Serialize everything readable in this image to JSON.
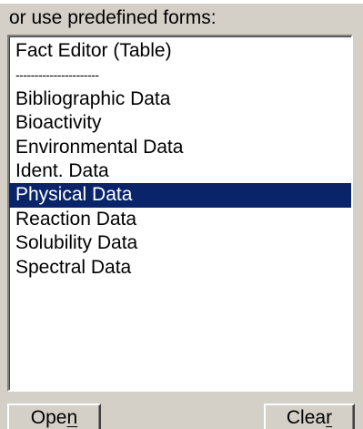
{
  "panel": {
    "caption": "or use predefined forms:",
    "forms": [
      {
        "label": "Fact Editor (Table)",
        "kind": "item",
        "selected": false
      },
      {
        "label": "----------------------",
        "kind": "separator",
        "selected": false
      },
      {
        "label": "Bibliographic Data",
        "kind": "item",
        "selected": false
      },
      {
        "label": "Bioactivity",
        "kind": "item",
        "selected": false
      },
      {
        "label": "Environmental Data",
        "kind": "item",
        "selected": false
      },
      {
        "label": "Ident. Data",
        "kind": "item",
        "selected": false
      },
      {
        "label": "Physical Data",
        "kind": "item",
        "selected": true
      },
      {
        "label": "Reaction Data",
        "kind": "item",
        "selected": false
      },
      {
        "label": "Solubility Data",
        "kind": "item",
        "selected": false
      },
      {
        "label": "Spectral Data",
        "kind": "item",
        "selected": false
      }
    ],
    "buttons": {
      "open_label": "Open",
      "open_accel_before": "Ope",
      "open_accel_char": "n",
      "clear_label": "Clear",
      "clear_accel_before": "Clea",
      "clear_accel_char": "r"
    }
  },
  "colors": {
    "window_bg": "#d4d0c8",
    "list_bg": "#ffffff",
    "selection_bg": "#0a246a",
    "selection_text": "#ffffff"
  }
}
